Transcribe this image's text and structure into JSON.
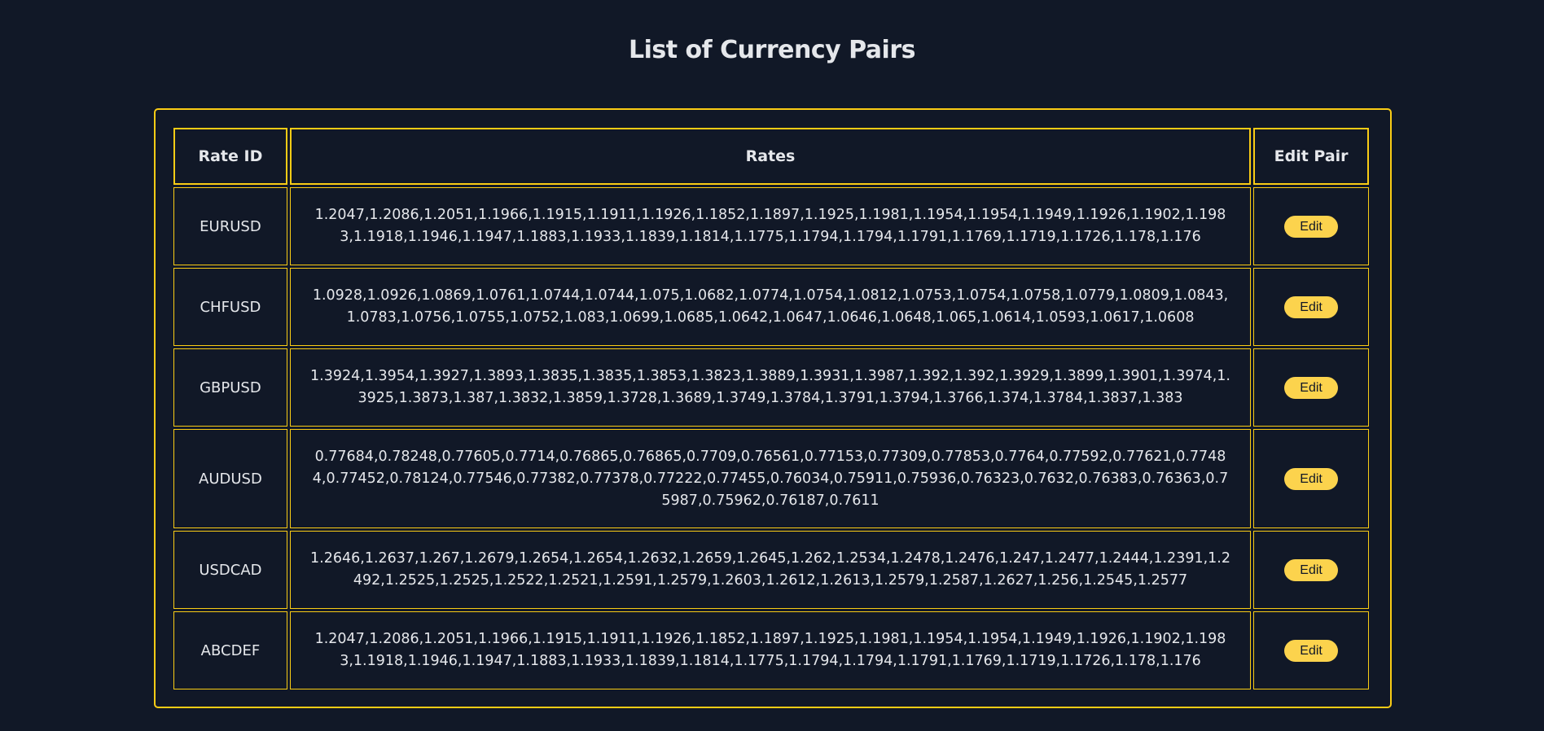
{
  "page": {
    "title": "List of Currency Pairs"
  },
  "table": {
    "headers": {
      "rate_id": "Rate ID",
      "rates": "Rates",
      "edit_pair": "Edit Pair"
    },
    "rows": [
      {
        "id": "EURUSD",
        "rates": "1.2047,1.2086,1.2051,1.1966,1.1915,1.1911,1.1926,1.1852,1.1897,1.1925,1.1981,1.1954,1.1954,1.1949,1.1926,1.1902,1.1983,1.1918,1.1946,1.1947,1.1883,1.1933,1.1839,1.1814,1.1775,1.1794,1.1794,1.1791,1.1769,1.1719,1.1726,1.178,1.176",
        "edit_label": "Edit"
      },
      {
        "id": "CHFUSD",
        "rates": "1.0928,1.0926,1.0869,1.0761,1.0744,1.0744,1.075,1.0682,1.0774,1.0754,1.0812,1.0753,1.0754,1.0758,1.0779,1.0809,1.0843,1.0783,1.0756,1.0755,1.0752,1.083,1.0699,1.0685,1.0642,1.0647,1.0646,1.0648,1.065,1.0614,1.0593,1.0617,1.0608",
        "edit_label": "Edit"
      },
      {
        "id": "GBPUSD",
        "rates": "1.3924,1.3954,1.3927,1.3893,1.3835,1.3835,1.3853,1.3823,1.3889,1.3931,1.3987,1.392,1.392,1.3929,1.3899,1.3901,1.3974,1.3925,1.3873,1.387,1.3832,1.3859,1.3728,1.3689,1.3749,1.3784,1.3791,1.3794,1.3766,1.374,1.3784,1.3837,1.383",
        "edit_label": "Edit"
      },
      {
        "id": "AUDUSD",
        "rates": "0.77684,0.78248,0.77605,0.7714,0.76865,0.76865,0.7709,0.76561,0.77153,0.77309,0.77853,0.7764,0.77592,0.77621,0.77484,0.77452,0.78124,0.77546,0.77382,0.77378,0.77222,0.77455,0.76034,0.75911,0.75936,0.76323,0.7632,0.76383,0.76363,0.75987,0.75962,0.76187,0.7611",
        "edit_label": "Edit"
      },
      {
        "id": "USDCAD",
        "rates": "1.2646,1.2637,1.267,1.2679,1.2654,1.2654,1.2632,1.2659,1.2645,1.262,1.2534,1.2478,1.2476,1.247,1.2477,1.2444,1.2391,1.2492,1.2525,1.2525,1.2522,1.2521,1.2591,1.2579,1.2603,1.2612,1.2613,1.2579,1.2587,1.2627,1.256,1.2545,1.2577",
        "edit_label": "Edit"
      },
      {
        "id": "ABCDEF",
        "rates": "1.2047,1.2086,1.2051,1.1966,1.1915,1.1911,1.1926,1.1852,1.1897,1.1925,1.1981,1.1954,1.1954,1.1949,1.1926,1.1902,1.1983,1.1918,1.1946,1.1947,1.1883,1.1933,1.1839,1.1814,1.1775,1.1794,1.1794,1.1791,1.1769,1.1719,1.1726,1.178,1.176",
        "edit_label": "Edit"
      }
    ]
  },
  "colors": {
    "background": "#111827",
    "accent": "#facc15",
    "button": "#fcd34d",
    "text": "#e5e7eb"
  }
}
